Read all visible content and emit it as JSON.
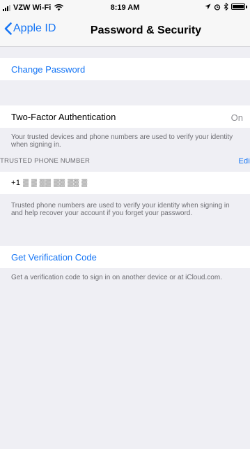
{
  "status_bar": {
    "carrier": "VZW Wi-Fi",
    "time": "8:19 AM",
    "icons": [
      "wifi-icon",
      "location-icon",
      "alarm-icon",
      "bluetooth-icon",
      "battery-icon"
    ]
  },
  "nav": {
    "back_label": "Apple ID",
    "title": "Password & Security"
  },
  "change_password": {
    "label": "Change Password"
  },
  "two_factor": {
    "label": "Two-Factor Authentication",
    "value": "On",
    "footer": "Your trusted devices and phone numbers are used to verify your identity when signing in."
  },
  "trusted_phone": {
    "header": "TRUSTED PHONE NUMBER",
    "edit_label": "Edi",
    "number": "+1 ▒ ▒ ▒▒ ▒▒ ▒▒ ▒",
    "footer": "Trusted phone numbers are used to verify your identity when signing in and help recover your account if you forget your password."
  },
  "verification": {
    "label": "Get Verification Code",
    "footer": "Get a verification code to sign in on another device or at iCloud.com."
  },
  "colors": {
    "accent": "#1575f5",
    "background": "#efeff4",
    "secondary_text": "#6d6d72"
  }
}
